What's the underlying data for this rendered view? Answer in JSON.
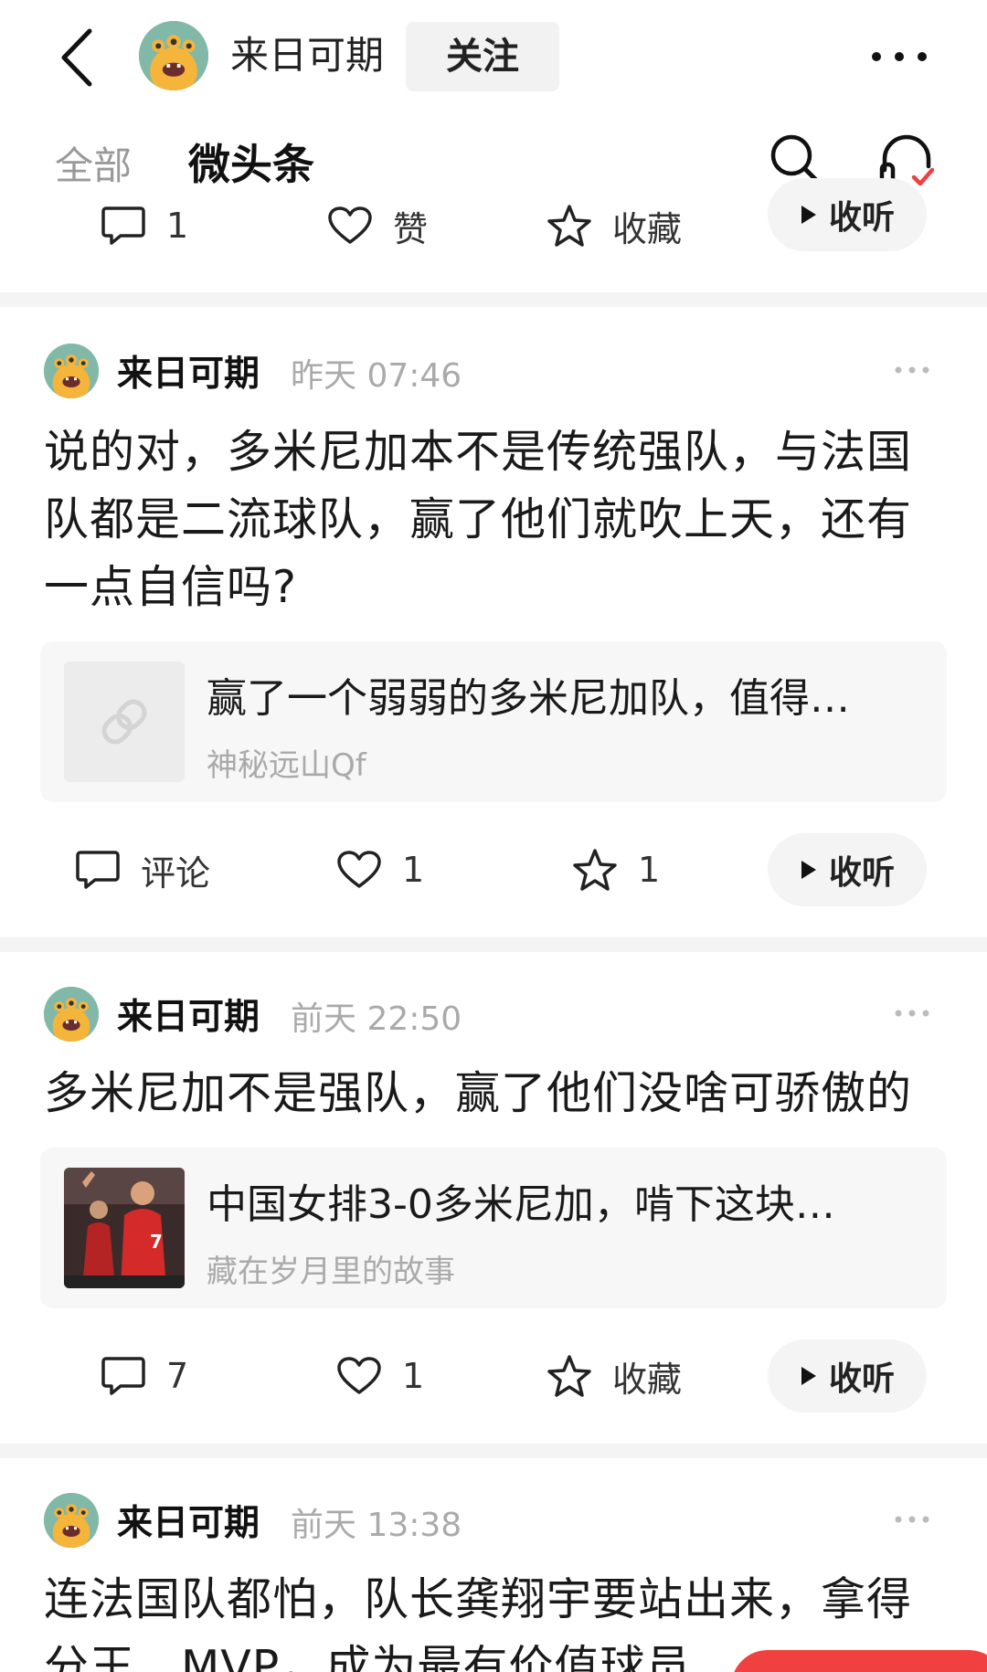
{
  "header": {
    "account_name": "来日可期",
    "follow_label": "关注",
    "icons": {
      "back": "back-icon",
      "more": "more-icon"
    }
  },
  "tabs": {
    "all_label": "全部",
    "micro_label": "微头条",
    "icons": {
      "search": "search-icon",
      "listen": "headphones-icon"
    }
  },
  "top_actions": {
    "comments": "1",
    "like_label": "赞",
    "favorite_label": "收藏",
    "listen_label": "收听"
  },
  "posts": [
    {
      "author": "来日可期",
      "time": "昨天  07:46",
      "text": "说的对，多米尼加本不是传统强队，与法国队都是二流球队，赢了他们就吹上天，还有一点自信吗?",
      "card": {
        "title": "赢了一个弱弱的多米尼加队，值得…",
        "source": "神秘远山Qf",
        "thumb": "link-icon"
      },
      "actions": {
        "comment_label": "评论",
        "likes": "1",
        "favorites": "1",
        "listen_label": "收听"
      }
    },
    {
      "author": "来日可期",
      "time": "前天  22:50",
      "text": "多米尼加不是强队，赢了他们没啥可骄傲的",
      "card": {
        "title": "中国女排3-0多米尼加，啃下这块…",
        "source": "藏在岁月里的故事",
        "thumb": "volleyball-photo"
      },
      "actions": {
        "comments": "7",
        "likes": "1",
        "favorite_label": "收藏",
        "listen_label": "收听"
      }
    },
    {
      "author": "来日可期",
      "time": "前天  13:38",
      "text": "连法国队都怕，队长龚翔宇要站出来，拿得分王、MVP，成为最有价值球员"
    }
  ],
  "colors": {
    "accent_red": "#f04040",
    "divider": "#f4f4f4",
    "muted": "#aaaaaa"
  }
}
